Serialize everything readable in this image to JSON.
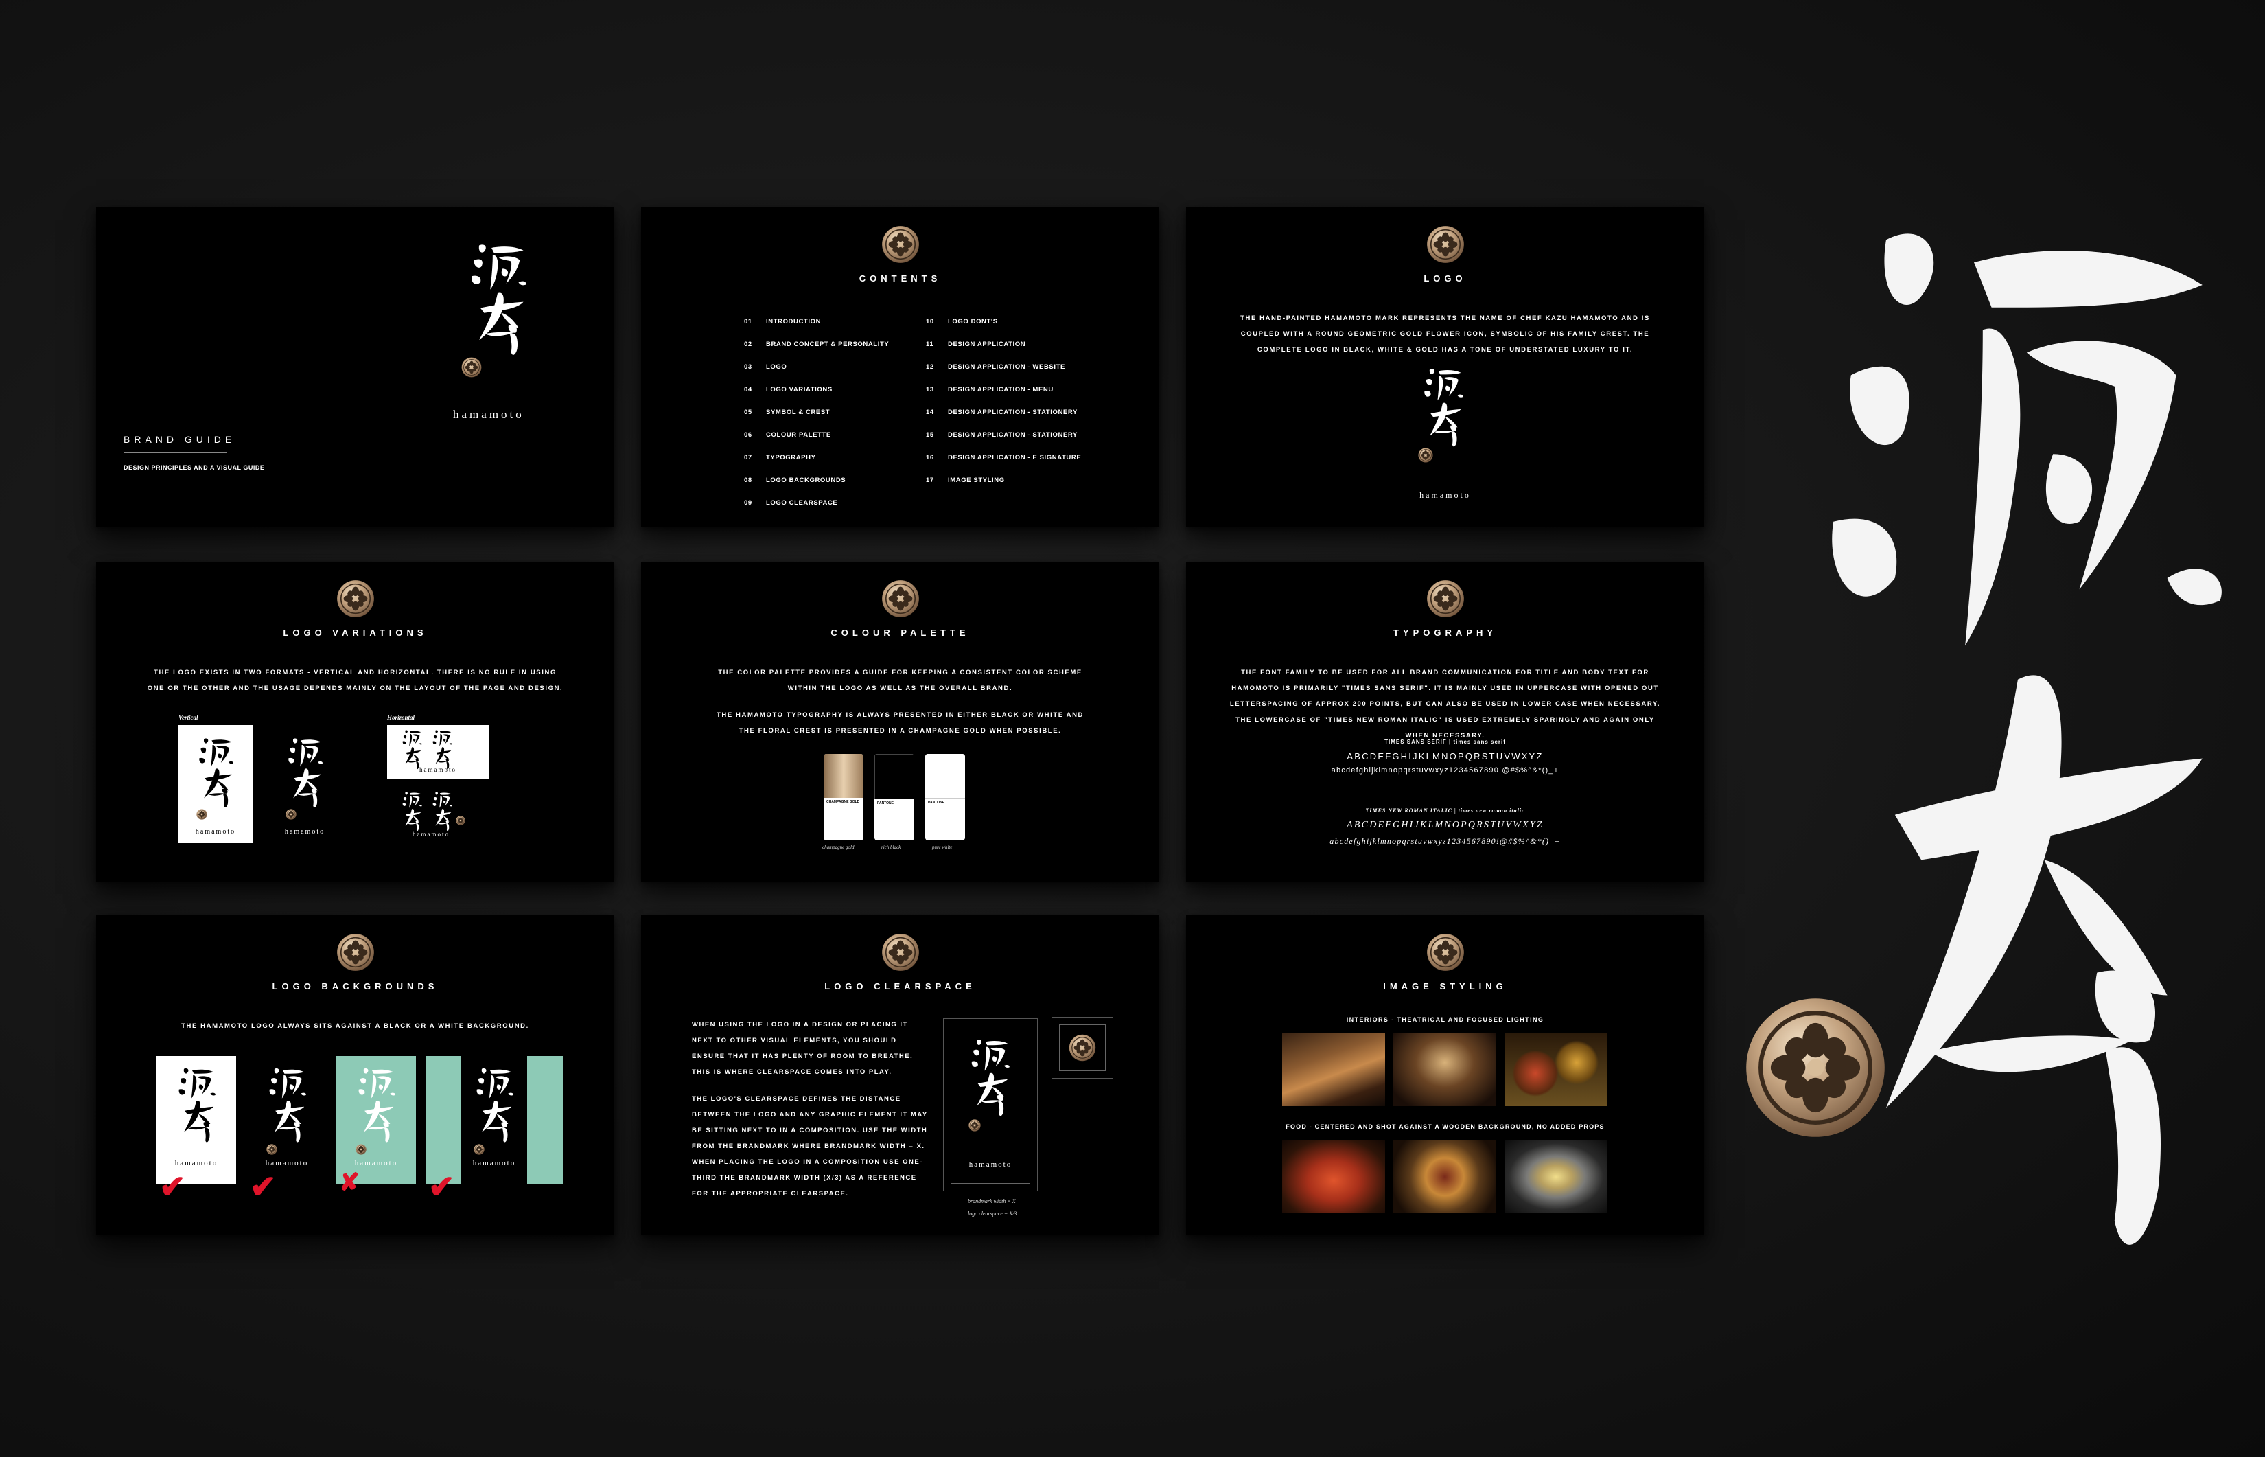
{
  "logo": {
    "wordmark": "hamamoto"
  },
  "colors": {
    "gold": "#b89a78",
    "black": "#000000",
    "white": "#ffffff",
    "mint": "#8dcab6",
    "red_mark": "#e0142a"
  },
  "slides": {
    "cover": {
      "title": "BRAND GUIDE",
      "subtitle": "DESIGN PRINCIPLES AND A VISUAL GUIDE"
    },
    "contents": {
      "title": "CONTENTS",
      "left": [
        {
          "num": "01",
          "label": "INTRODUCTION"
        },
        {
          "num": "02",
          "label": "BRAND CONCEPT & PERSONALITY"
        },
        {
          "num": "03",
          "label": "LOGO"
        },
        {
          "num": "04",
          "label": "LOGO VARIATIONS"
        },
        {
          "num": "05",
          "label": "SYMBOL & CREST"
        },
        {
          "num": "06",
          "label": "COLOUR PALETTE"
        },
        {
          "num": "07",
          "label": "TYPOGRAPHY"
        },
        {
          "num": "08",
          "label": "LOGO BACKGROUNDS"
        },
        {
          "num": "09",
          "label": "LOGO CLEARSPACE"
        }
      ],
      "right": [
        {
          "num": "10",
          "label": "LOGO DONT'S"
        },
        {
          "num": "11",
          "label": "DESIGN APPLICATION"
        },
        {
          "num": "12",
          "label": "DESIGN APPLICATION - WEBSITE"
        },
        {
          "num": "13",
          "label": "DESIGN APPLICATION - MENU"
        },
        {
          "num": "14",
          "label": "DESIGN APPLICATION - STATIONERY"
        },
        {
          "num": "15",
          "label": "DESIGN APPLICATION - STATIONERY"
        },
        {
          "num": "16",
          "label": "DESIGN APPLICATION - E SIGNATURE"
        },
        {
          "num": "17",
          "label": "IMAGE STYLING"
        }
      ]
    },
    "logo": {
      "title": "LOGO",
      "body": "THE HAND-PAINTED HAMAMOTO MARK REPRESENTS THE NAME OF CHEF KAZU HAMAMOTO AND IS COUPLED WITH A ROUND GEOMETRIC GOLD FLOWER ICON, SYMBOLIC OF HIS FAMILY CREST. THE COMPLETE LOGO IN BLACK, WHITE & GOLD HAS A TONE OF UNDERSTATED LUXURY TO IT."
    },
    "variations": {
      "title": "LOGO VARIATIONS",
      "body": "THE LOGO EXISTS IN TWO FORMATS - VERTICAL AND HORIZONTAL. THERE IS NO RULE IN USING ONE OR THE OTHER AND THE USAGE DEPENDS MAINLY ON THE LAYOUT OF THE PAGE AND DESIGN.",
      "vertical_label": "Vertical",
      "horizontal_label": "Horizontal"
    },
    "palette": {
      "title": "COLOUR PALETTE",
      "body1": "THE COLOR PALETTE PROVIDES A GUIDE FOR KEEPING A CONSISTENT COLOR SCHEME WITHIN THE LOGO AS WELL AS THE OVERALL BRAND.",
      "body2": "THE HAMAMOTO TYPOGRAPHY IS ALWAYS PRESENTED IN EITHER BLACK OR WHITE AND THE FLORAL CREST IS PRESENTED IN A CHAMPAGNE GOLD WHEN POSSIBLE.",
      "swatches": [
        {
          "label": "CHAMPAGNE GOLD",
          "caption": "champagne gold"
        },
        {
          "label": "PANTONE",
          "caption": "rich black"
        },
        {
          "label": "PANTONE",
          "caption": "pure white"
        }
      ]
    },
    "typography": {
      "title": "TYPOGRAPHY",
      "body": "THE FONT FAMILY TO BE USED FOR ALL BRAND COMMUNICATION FOR TITLE AND BODY TEXT FOR HAMOMOTO IS PRIMARILY \"TIMES SANS SERIF\". IT IS MAINLY USED IN UPPERCASE WITH OPENED OUT LETTERSPACING OF APPROX 200 POINTS, BUT CAN ALSO BE USED IN LOWER CASE WHEN NECESSARY. THE LOWERCASE OF \"TIMES NEW ROMAN ITALIC\" IS USED EXTREMELY SPARINGLY AND AGAIN ONLY WHEN NECESSARY.",
      "sans_label": "TIMES SANS SERIF | times sans serif",
      "sans_upper": "ABCDEFGHIJKLMNOPQRSTUVWXYZ",
      "sans_lower": "abcdefghijklmnopqrstuvwxyz1234567890!@#$%^&*()_+",
      "serif_label": "TIMES NEW ROMAN ITALIC | times new roman italic",
      "serif_upper": "ABCDEFGHIJKLMNOPQRSTUVWXYZ",
      "serif_lower": "abcdefghijklmnopqrstuvwxyz1234567890!@#$%^&*()_+"
    },
    "backgrounds": {
      "title": "LOGO BACKGROUNDS",
      "body": "THE HAMAMOTO LOGO ALWAYS SITS AGAINST A BLACK OR A WHITE BACKGROUND.",
      "marks": [
        "✔",
        "✔",
        "✘",
        "✔"
      ]
    },
    "clearspace": {
      "title": "LOGO CLEARSPACE",
      "p1": "WHEN USING THE LOGO IN A DESIGN OR PLACING IT NEXT TO OTHER VISUAL ELEMENTS, YOU SHOULD ENSURE THAT IT HAS PLENTY OF ROOM TO BREATHE. THIS IS WHERE CLEARSPACE COMES INTO PLAY.",
      "p2": "THE LOGO'S CLEARSPACE DEFINES THE DISTANCE BETWEEN THE LOGO AND ANY GRAPHIC ELEMENT IT MAY BE SITTING NEXT TO IN A COMPOSITION. USE THE WIDTH FROM THE BRANDMARK WHERE BRANDMARK WIDTH = X. WHEN PLACING THE LOGO IN A COMPOSITION USE ONE-THIRD THE BRANDMARK WIDTH (X/3) AS A REFERENCE FOR THE APPROPRIATE CLEARSPACE.",
      "note1": "brandmark width = X",
      "note2": "logo clearspace = X/3"
    },
    "imagery": {
      "title": "IMAGE STYLING",
      "interiors": "INTERIORS - THEATRICAL AND FOCUSED LIGHTING",
      "food": "FOOD - CENTERED AND SHOT AGAINST A WOODEN BACKGROUND, NO ADDED PROPS"
    }
  }
}
